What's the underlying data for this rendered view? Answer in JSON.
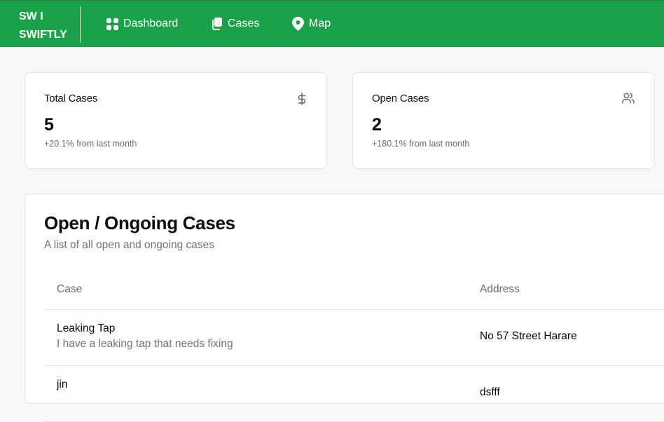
{
  "brand": {
    "line1": "SW I",
    "line2": "SWIFTLY"
  },
  "nav": [
    {
      "label": "Dashboard",
      "icon": "dashboard-grid-icon"
    },
    {
      "label": "Cases",
      "icon": "cases-copy-icon"
    },
    {
      "label": "Map",
      "icon": "map-pin-icon"
    }
  ],
  "stats": [
    {
      "title": "Total Cases",
      "value": "5",
      "sub": "+20.1% from last month",
      "icon": "dollar-icon"
    },
    {
      "title": "Open Cases",
      "value": "2",
      "sub": "+180.1% from last month",
      "icon": "users-icon"
    }
  ],
  "cases": {
    "title": "Open / Ongoing Cases",
    "description": "A list of all open and ongoing cases",
    "columns": {
      "case": "Case",
      "address": "Address"
    },
    "rows": [
      {
        "title": "Leaking Tap",
        "description": "I have a leaking tap that needs fixing",
        "address": "No 57 Street Harare"
      },
      {
        "title": "jin",
        "description": "",
        "address": "dsfff"
      }
    ]
  },
  "colors": {
    "primary": "#19a24a",
    "background": "#f8f8f8",
    "border": "#e4e4e7",
    "muted": "#737373"
  }
}
